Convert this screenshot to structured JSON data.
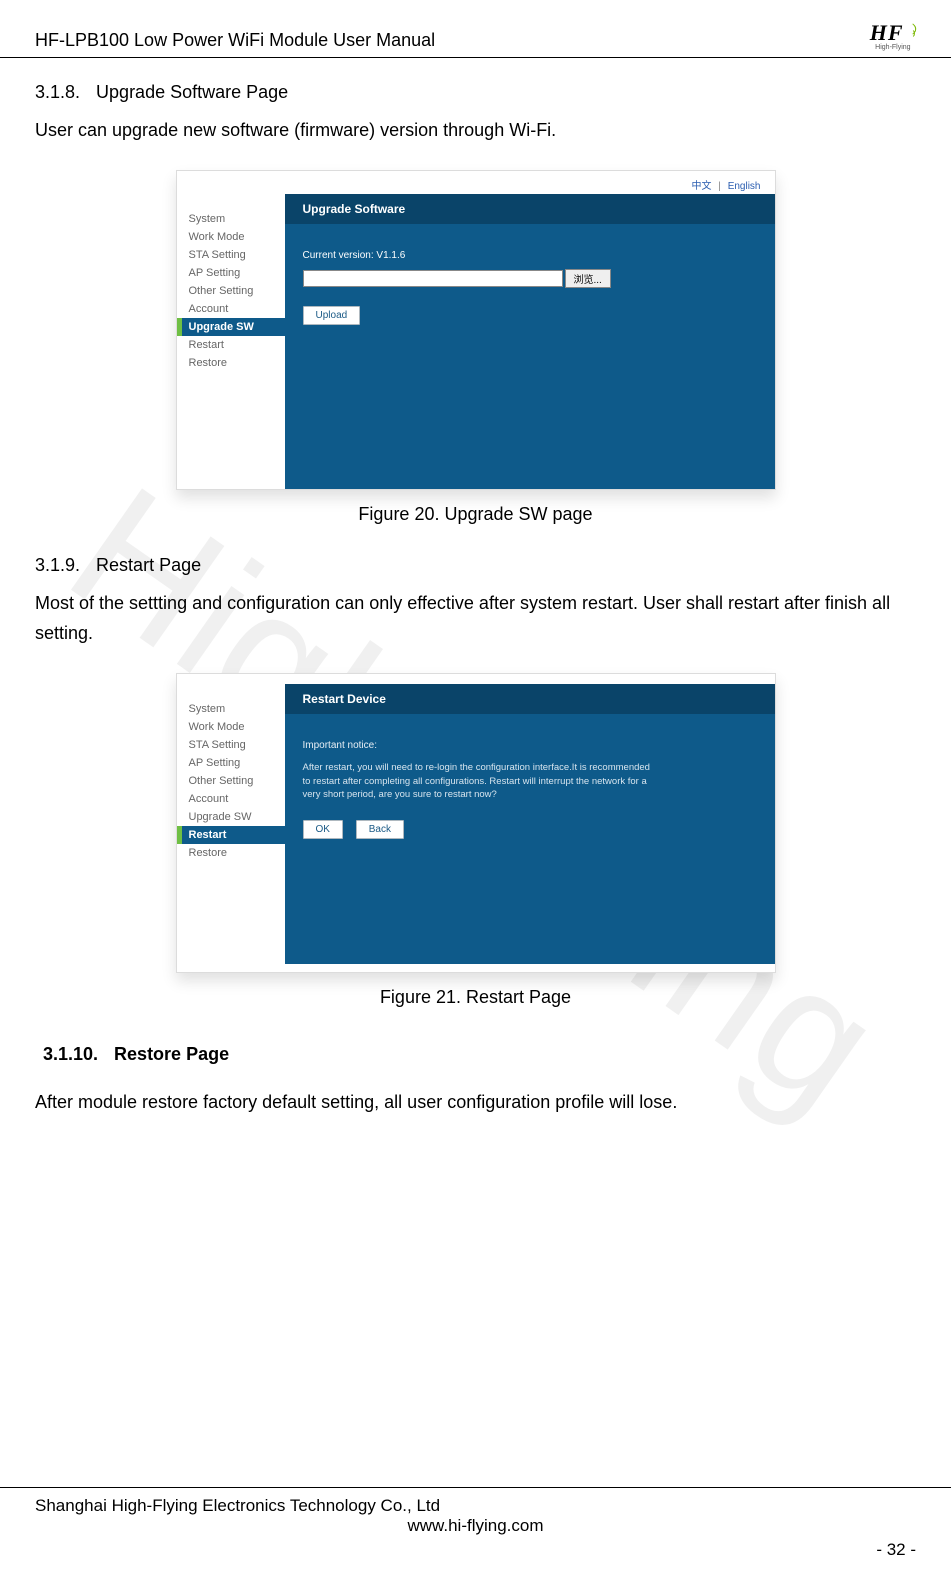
{
  "header": {
    "title": "HF-LPB100 Low Power WiFi Module User Manual",
    "logo_text": "HF",
    "logo_sub": "High-Flying"
  },
  "watermark": "High-Flying",
  "section_318": {
    "number": "3.1.8.",
    "title": "Upgrade Software Page",
    "body": "User can upgrade new software (firmware) version through Wi-Fi."
  },
  "figure20": {
    "caption": "Figure 20.   Upgrade SW page",
    "lang_cn": "中文",
    "lang_en": "English",
    "sidebar": [
      "System",
      "Work Mode",
      "STA Setting",
      "AP Setting",
      "Other Setting",
      "Account",
      "Upgrade SW",
      "Restart",
      "Restore"
    ],
    "active_index": 6,
    "panel_title": "Upgrade Software",
    "version_label": "Current version: V1.1.6",
    "browse_label": "浏览...",
    "upload_label": "Upload"
  },
  "section_319": {
    "number": "3.1.9.",
    "title": "Restart Page",
    "body": "Most of the settting and configuration can only effective after system restart. User shall restart after finish all setting."
  },
  "figure21": {
    "caption": "Figure 21.   Restart Page",
    "sidebar": [
      "System",
      "Work Mode",
      "STA Setting",
      "AP Setting",
      "Other Setting",
      "Account",
      "Upgrade SW",
      "Restart",
      "Restore"
    ],
    "active_index": 7,
    "panel_title": "Restart Device",
    "notice_title": "Important notice:",
    "notice_body": "After restart, you will need to re-login the configuration interface.It is recommended to restart after completing all configurations. Restart will interrupt the network for a very short period, are you sure to restart now?",
    "ok_label": "OK",
    "back_label": "Back"
  },
  "section_3110": {
    "number": "3.1.10.",
    "title": "Restore Page",
    "body": "After module restore factory default setting, all user configuration profile will lose."
  },
  "footer": {
    "company": "Shanghai High-Flying Electronics Technology Co., Ltd",
    "url": "www.hi-flying.com",
    "page": "- 32 -"
  }
}
